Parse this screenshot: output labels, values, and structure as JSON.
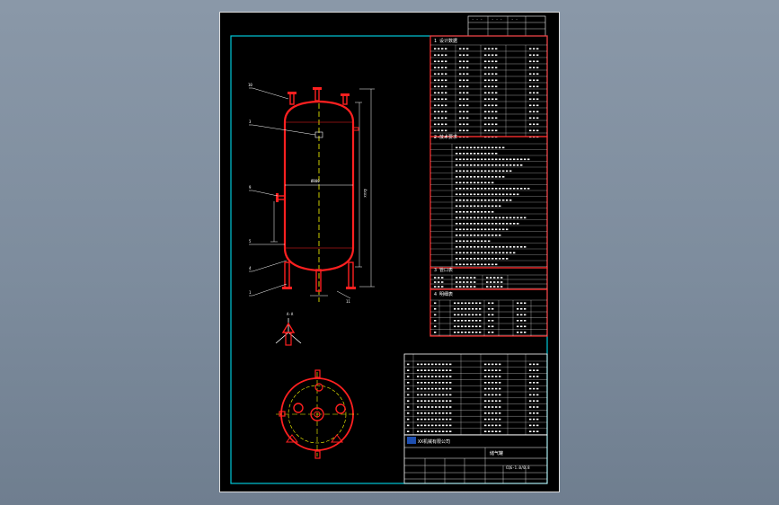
{
  "drawing": {
    "section_headers": [
      "1 设计数据",
      "2 技术要求",
      "3 管口表",
      "4 明细表"
    ],
    "part_labels": [
      "10",
      "3",
      "9",
      "5",
      "4",
      "1",
      "11"
    ],
    "dimension_labels": [
      "4xxx",
      "Ø800"
    ],
    "view_label": "A-A",
    "title_block": {
      "company": "XX机械有限公司",
      "drawing_name": "储气罐",
      "drawing_no": "CQG-1.0/0.8"
    }
  },
  "colors": {
    "background": "#7f8e9f",
    "sheet": "#000000",
    "border": "#00c8d8",
    "vessel": "#ff2020",
    "line": "#ffffff",
    "table_line": "#ff3030",
    "annotation": "#ffffff",
    "centerline": "#ffff00"
  }
}
